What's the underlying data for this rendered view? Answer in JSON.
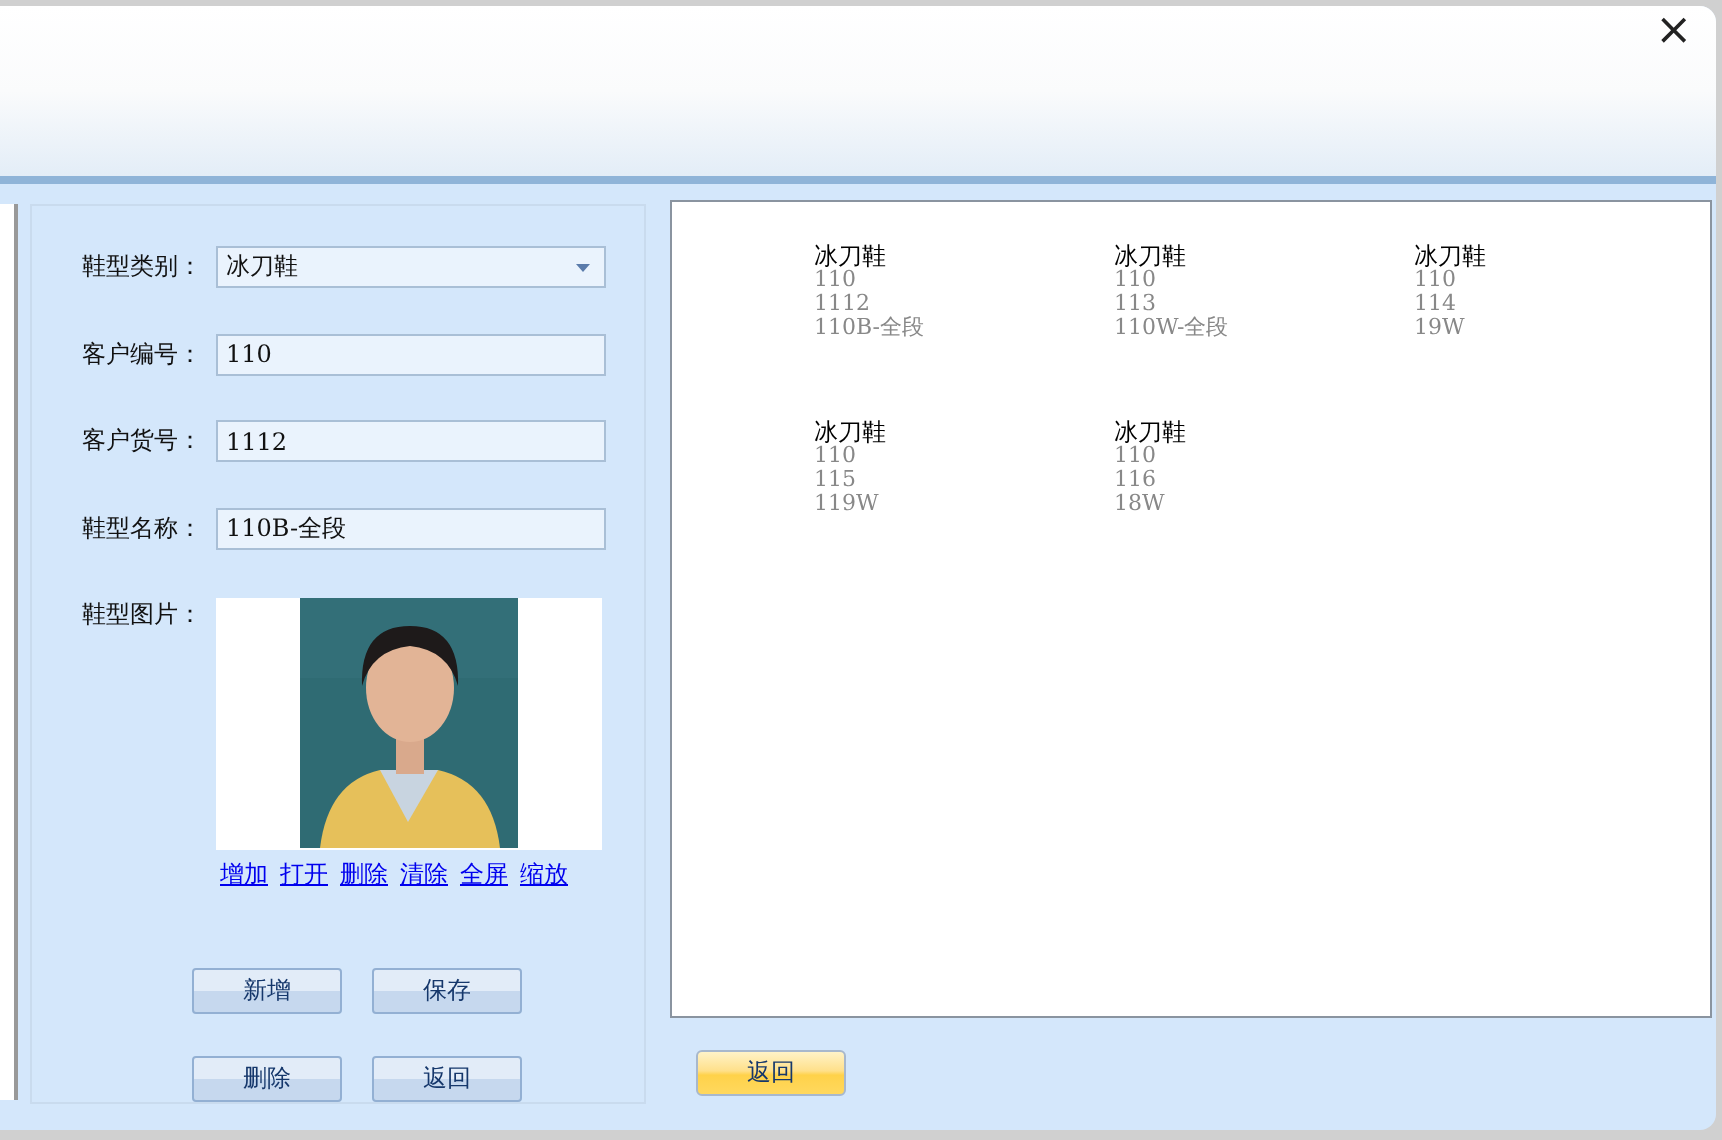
{
  "window": {
    "close": "×"
  },
  "form": {
    "fields": [
      {
        "label": "鞋型类别：",
        "kind": "dropdown",
        "value": "冰刀鞋"
      },
      {
        "label": "客户编号：",
        "kind": "text",
        "value": "110"
      },
      {
        "label": "客户货号：",
        "kind": "text",
        "value": "1112"
      },
      {
        "label": "鞋型名称：",
        "kind": "text",
        "value": "110B-全段"
      }
    ],
    "image_label": "鞋型图片：",
    "image": {
      "kind": "picture"
    },
    "image_links": [
      "增加",
      "打开",
      "删除",
      "清除",
      "全屏",
      "缩放"
    ],
    "buttons": [
      "新增",
      "保存",
      "删除",
      "返回"
    ]
  },
  "cards": [
    {
      "title": "冰刀鞋",
      "lines": [
        "110",
        "1112",
        "110B-全段"
      ]
    },
    {
      "title": "冰刀鞋",
      "lines": [
        "110",
        "113",
        "110W-全段"
      ]
    },
    {
      "title": "冰刀鞋",
      "lines": [
        "110",
        "114",
        "19W"
      ]
    },
    {
      "title": "冰刀鞋",
      "lines": [
        "110",
        "115",
        "119W"
      ]
    },
    {
      "title": "冰刀鞋",
      "lines": [
        "110",
        "116",
        "18W"
      ]
    }
  ],
  "return_button": "返回"
}
